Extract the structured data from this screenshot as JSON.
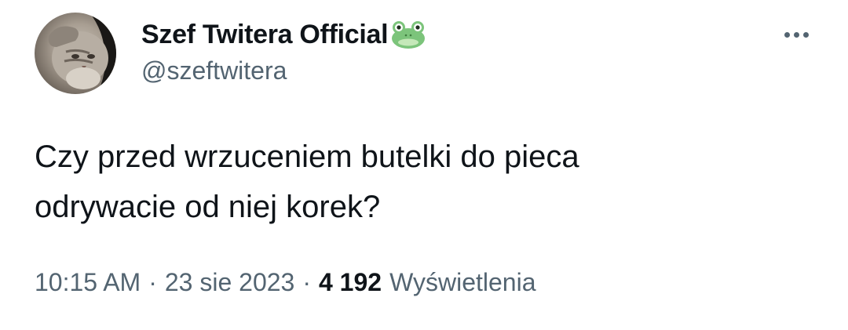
{
  "author": {
    "display_name": "Szef Twitera Official",
    "handle": "@szeftwitera",
    "badge_icon": "frog-emoji-icon",
    "avatar_icon": "cat-salute-avatar"
  },
  "more_menu": {
    "icon": "more-horizontal-icon"
  },
  "tweet": {
    "text": "Czy przed wrzuceniem butelki do pieca\nodrywacie od niej korek?"
  },
  "meta": {
    "time": "10:15 AM",
    "separator": "·",
    "date": "23 sie 2023",
    "views_count": "4 192",
    "views_label": "Wyświetlenia"
  },
  "colors": {
    "primary_text": "#0f1419",
    "secondary_text": "#536471",
    "background": "#ffffff",
    "frog_green": "#7cc47b"
  }
}
